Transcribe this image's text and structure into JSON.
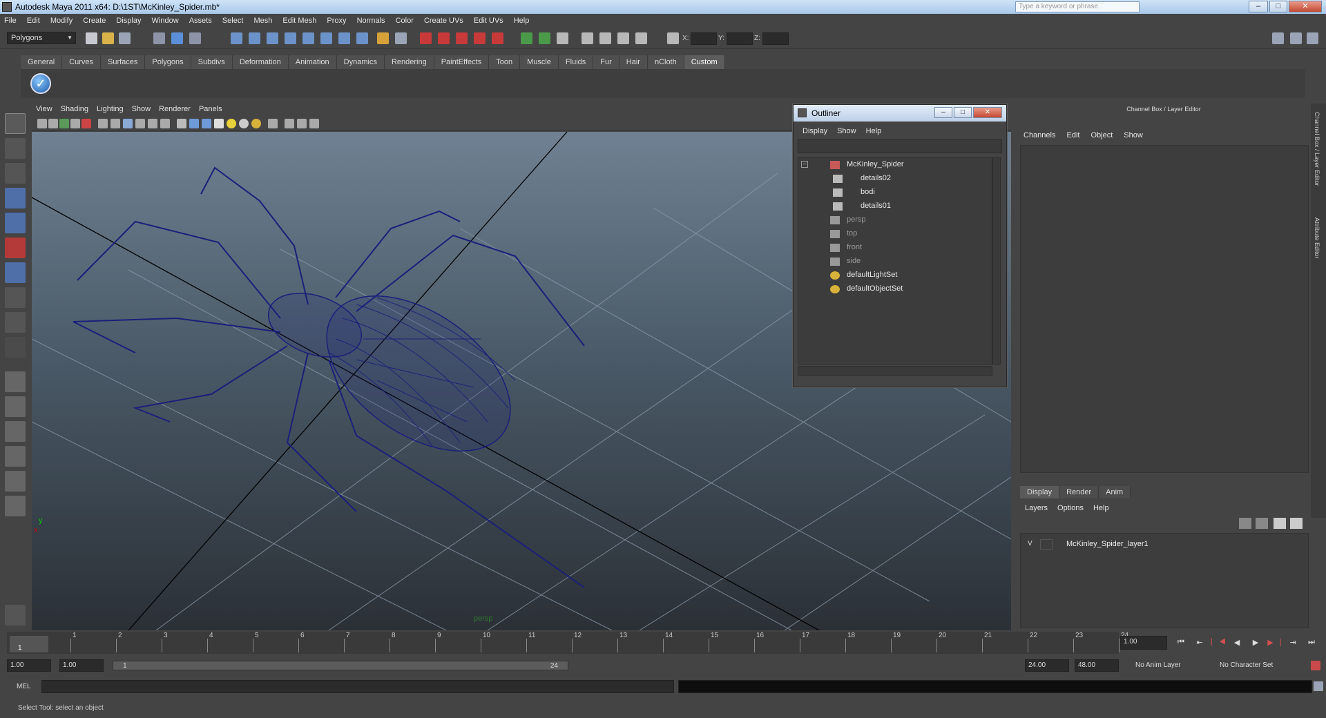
{
  "window": {
    "title": "Autodesk Maya 2011 x64: D:\\1ST\\McKinley_Spider.mb*",
    "search_placeholder": "Type a keyword or phrase",
    "minimize": "–",
    "maximize": "□",
    "close": "✕"
  },
  "menubar": [
    "File",
    "Edit",
    "Modify",
    "Create",
    "Display",
    "Window",
    "Assets",
    "Select",
    "Mesh",
    "Edit Mesh",
    "Proxy",
    "Normals",
    "Color",
    "Create UVs",
    "Edit UVs",
    "Help"
  ],
  "statusline": {
    "mode": "Polygons",
    "x_label": "X:",
    "y_label": "Y:",
    "z_label": "Z:"
  },
  "shelf": {
    "tabs": [
      "General",
      "Curves",
      "Surfaces",
      "Polygons",
      "Subdivs",
      "Deformation",
      "Animation",
      "Dynamics",
      "Rendering",
      "PaintEffects",
      "Toon",
      "Muscle",
      "Fluids",
      "Fur",
      "Hair",
      "nCloth",
      "Custom"
    ],
    "active": "Custom"
  },
  "viewport": {
    "menu": [
      "View",
      "Shading",
      "Lighting",
      "Show",
      "Renderer",
      "Panels"
    ],
    "camera_label": "persp",
    "axis_x": "x",
    "axis_y": "y",
    "colors": {
      "wire": "#1a1f7a",
      "grid": "#8b9bab",
      "axis": "#000000"
    }
  },
  "outliner": {
    "title": "Outliner",
    "menu": [
      "Display",
      "Show",
      "Help"
    ],
    "items": [
      {
        "label": "McKinley_Spider",
        "depth": 0,
        "dim": false
      },
      {
        "label": "details02",
        "depth": 1,
        "dim": false
      },
      {
        "label": "bodi",
        "depth": 1,
        "dim": false
      },
      {
        "label": "details01",
        "depth": 1,
        "dim": false
      },
      {
        "label": "persp",
        "depth": 0,
        "dim": true
      },
      {
        "label": "top",
        "depth": 0,
        "dim": true
      },
      {
        "label": "front",
        "depth": 0,
        "dim": true
      },
      {
        "label": "side",
        "depth": 0,
        "dim": true
      },
      {
        "label": "defaultLightSet",
        "depth": 0,
        "dim": false
      },
      {
        "label": "defaultObjectSet",
        "depth": 0,
        "dim": false
      }
    ]
  },
  "channel_box": {
    "title": "Channel Box / Layer Editor",
    "menu": [
      "Channels",
      "Edit",
      "Object",
      "Show"
    ],
    "layer_tabs": [
      "Display",
      "Render",
      "Anim"
    ],
    "layer_menu": [
      "Layers",
      "Options",
      "Help"
    ],
    "layer": {
      "visible": "V",
      "name": "McKinley_Spider_layer1"
    },
    "side_tabs": [
      "Channel Box / Layer Editor",
      "Attribute Editor"
    ]
  },
  "timeline": {
    "ticks": [
      "1",
      "2",
      "3",
      "4",
      "5",
      "6",
      "7",
      "8",
      "9",
      "10",
      "11",
      "12",
      "13",
      "14",
      "15",
      "16",
      "17",
      "18",
      "19",
      "20",
      "21",
      "22",
      "23",
      "24"
    ],
    "current_frame_marker": "1",
    "current_frame_field": "1.00"
  },
  "range": {
    "start": "1.00",
    "anim_start": "1.00",
    "range_start_label": "1",
    "range_end_label": "24",
    "end": "24.00",
    "anim_end": "48.00",
    "anim_layer": "No Anim Layer",
    "character_set": "No Character Set"
  },
  "command": {
    "label": "MEL"
  },
  "help_line": "Select Tool: select an object"
}
